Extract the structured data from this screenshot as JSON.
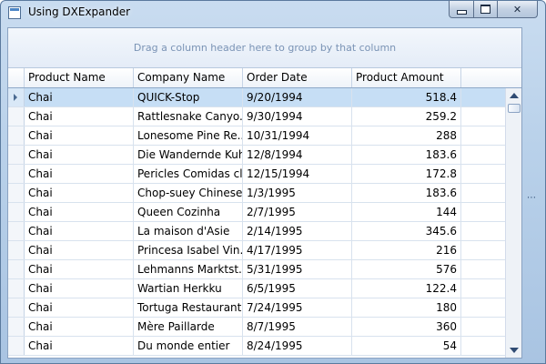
{
  "window": {
    "title": "Using DXExpander",
    "minimize_icon": "minimize-icon",
    "maximize_icon": "maximize-icon",
    "close_icon": "close-icon",
    "close_glyph": "✕"
  },
  "grid": {
    "group_panel_text": "Drag a column header here to group by that column",
    "columns": [
      "Product Name",
      "Company Name",
      "Order Date",
      "Product Amount"
    ],
    "rows": [
      {
        "product": "Chai",
        "company": "QUICK-Stop",
        "date": "9/20/1994",
        "amount": "518.4"
      },
      {
        "product": "Chai",
        "company": "Rattlesnake Canyo...",
        "date": "9/30/1994",
        "amount": "259.2"
      },
      {
        "product": "Chai",
        "company": "Lonesome Pine Re...",
        "date": "10/31/1994",
        "amount": "288"
      },
      {
        "product": "Chai",
        "company": "Die Wandernde Kuh",
        "date": "12/8/1994",
        "amount": "183.6"
      },
      {
        "product": "Chai",
        "company": "Pericles Comidas cl...",
        "date": "12/15/1994",
        "amount": "172.8"
      },
      {
        "product": "Chai",
        "company": "Chop-suey Chinese",
        "date": "1/3/1995",
        "amount": "183.6"
      },
      {
        "product": "Chai",
        "company": "Queen Cozinha",
        "date": "2/7/1995",
        "amount": "144"
      },
      {
        "product": "Chai",
        "company": "La maison d'Asie",
        "date": "2/14/1995",
        "amount": "345.6"
      },
      {
        "product": "Chai",
        "company": "Princesa Isabel Vin...",
        "date": "4/17/1995",
        "amount": "216"
      },
      {
        "product": "Chai",
        "company": "Lehmanns Marktst...",
        "date": "5/31/1995",
        "amount": "576"
      },
      {
        "product": "Chai",
        "company": "Wartian Herkku",
        "date": "6/5/1995",
        "amount": "122.4"
      },
      {
        "product": "Chai",
        "company": "Tortuga Restaurante",
        "date": "7/24/1995",
        "amount": "180"
      },
      {
        "product": "Chai",
        "company": "Mère Paillarde",
        "date": "8/7/1995",
        "amount": "360"
      },
      {
        "product": "Chai",
        "company": "Du monde entier",
        "date": "8/24/1995",
        "amount": "54"
      }
    ],
    "focused_row": 0
  },
  "expander": {
    "splitter_glyph": "⋯"
  }
}
